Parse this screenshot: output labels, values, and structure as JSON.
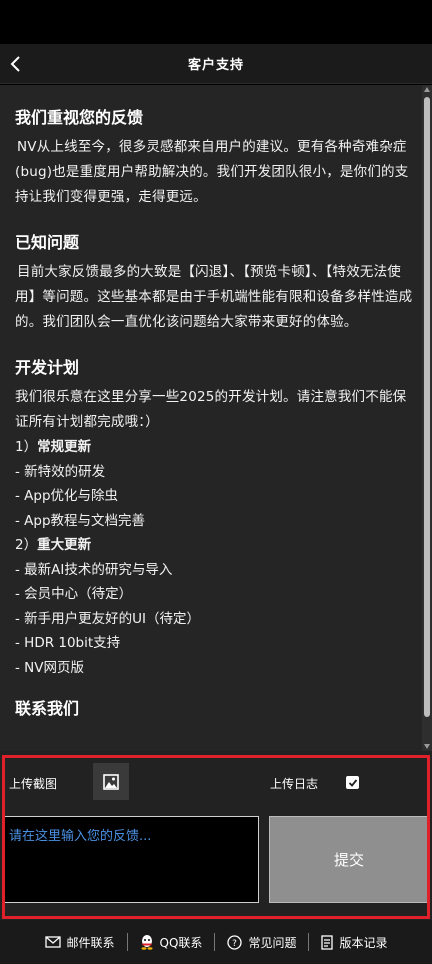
{
  "header": {
    "title": "客户支持",
    "back_icon": "chevron-left-icon"
  },
  "sections": [
    {
      "title": "我们重视您的反馈",
      "paragraph": "NV从上线至今，很多灵感都来自用户的建议。更有各种奇难杂症(bug)也是重度用户帮助解决的。我们开发团队很小，是你们的支持让我们变得更强，走得更远。"
    },
    {
      "title": "已知问题",
      "paragraph": "目前大家反馈最多的大致是【闪退】、【预览卡顿】、【特效无法使用】等问题。这些基本都是由于手机端性能有限和设备多样性造成的。我们团队会一直优化该问题给大家带来更好的体验。"
    },
    {
      "title": "开发计划",
      "paragraph": "我们很乐意在这里分享一些2025的开发计划。请注意我们不能保证所有计划都完成哦：）"
    },
    {
      "title": "联系我们"
    }
  ],
  "plan": {
    "regular_prefix": "1）",
    "regular_label": "常规更新",
    "regular_items": [
      "- 新特效的研发",
      "- App优化与除虫",
      "- App教程与文档完善"
    ],
    "major_prefix": "2）",
    "major_label": "重大更新",
    "major_items": [
      "- 最新AI技术的研究与导入",
      "- 会员中心（待定）",
      "- 新手用户更友好的UI（待定）",
      "- HDR 10bit支持",
      "- NV网页版"
    ]
  },
  "feedback": {
    "upload_screenshot_label": "上传截图",
    "upload_screenshot_icon": "image-icon",
    "upload_log_label": "上传日志",
    "upload_log_checked": true,
    "input_placeholder": "请在这里输入您的反馈...",
    "submit_label": "提交"
  },
  "bottom_nav": [
    {
      "label": "邮件联系",
      "icon": "mail-icon"
    },
    {
      "label": "QQ联系",
      "icon": "qq-icon"
    },
    {
      "label": "常见问题",
      "icon": "help-circle-icon"
    },
    {
      "label": "版本记录",
      "icon": "document-icon"
    }
  ],
  "colors": {
    "highlight": "#e0202a",
    "placeholder": "#4a90e2",
    "submit_bg": "#8f8f8f"
  }
}
